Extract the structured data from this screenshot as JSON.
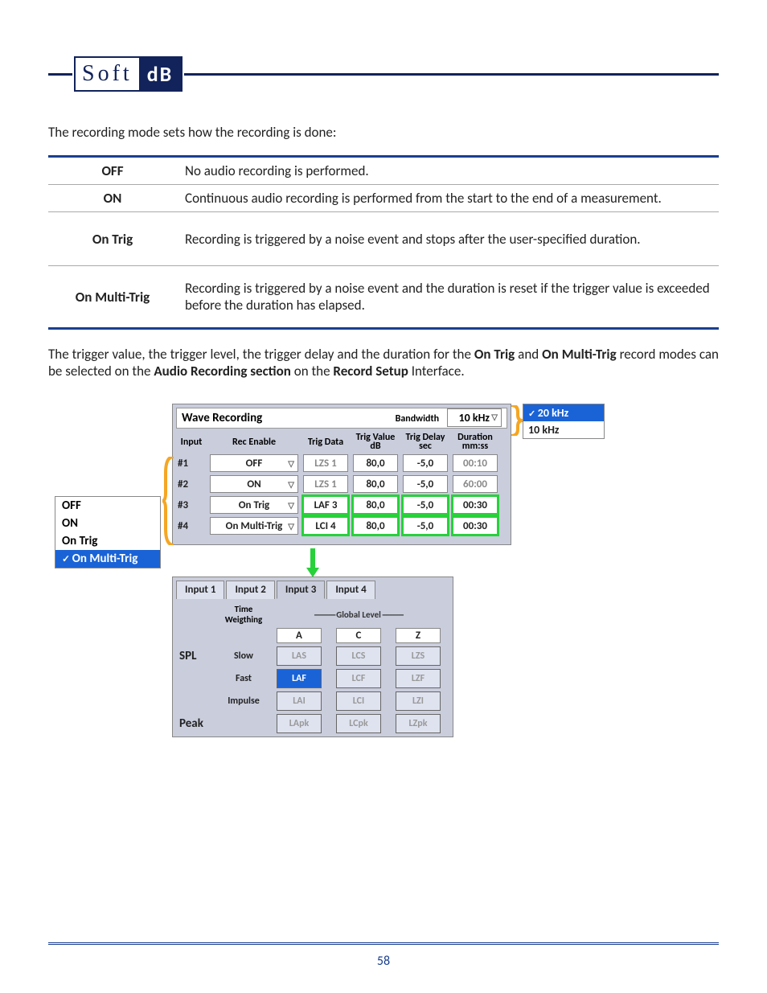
{
  "logo": {
    "left": "Soft",
    "right": "dB"
  },
  "intro": "The recording mode sets how the recording is done:",
  "modes": [
    {
      "name": "OFF",
      "desc": "No audio recording is performed."
    },
    {
      "name": "ON",
      "desc": "Continuous audio recording is performed from the start to the end of a measurement."
    },
    {
      "name": "On Trig",
      "desc": "Recording is triggered by a noise event and stops after the user-specified duration."
    },
    {
      "name": "On Multi-Trig",
      "desc": "Recording is triggered by a noise event and the duration is reset if the trigger value is exceeded before the duration has elapsed."
    }
  ],
  "para": {
    "p1": "The trigger value, the trigger level, the trigger delay and the duration for the ",
    "b1": "On Trig",
    "p2": " and ",
    "b2": "On Multi-Trig",
    "p3": " record modes can be selected on the ",
    "b3": "Audio Recording section",
    "p4": " on the ",
    "b4": "Record Setup",
    "p5": " Interface."
  },
  "wave": {
    "title": "Wave Recording",
    "bw_label": "Bandwidth",
    "bw_value": "10 kHz",
    "headers": {
      "input": "Input",
      "rec": "Rec Enable",
      "td": "Trig Data",
      "tv": "Trig Value",
      "tv2": "dB",
      "tdel": "Trig Delay",
      "tdel2": "sec",
      "dur": "Duration",
      "dur2": "mm:ss"
    },
    "rows": [
      {
        "in": "#1",
        "rec": "OFF",
        "td": "LZS 1",
        "tv": "80,0",
        "del": "-5,0",
        "dur": "00:10",
        "dim": true
      },
      {
        "in": "#2",
        "rec": "ON",
        "td": "LZS 1",
        "tv": "80,0",
        "del": "-5,0",
        "dur": "60:00",
        "dim": true
      },
      {
        "in": "#3",
        "rec": "On Trig",
        "td": "LAF 3",
        "tv": "80,0",
        "del": "-5,0",
        "dur": "00:30",
        "hl": true
      },
      {
        "in": "#4",
        "rec": "On Multi-Trig",
        "td": "LCI 4",
        "tv": "80,0",
        "del": "-5,0",
        "dur": "00:30",
        "hl": true
      }
    ]
  },
  "rec_dropdown": [
    "OFF",
    "ON",
    "On Trig",
    "On Multi-Trig"
  ],
  "rec_dropdown_selected": 3,
  "bw_dropdown": [
    "20 kHz",
    "10 kHz"
  ],
  "bw_dropdown_selected": 0,
  "spl": {
    "tabs": [
      "Input 1",
      "Input 2",
      "Input 3",
      "Input 4"
    ],
    "tab_selected": 2,
    "global_label": "Global Level",
    "tw_label": "Time Weigthing",
    "cols": [
      "A",
      "C",
      "Z"
    ],
    "rows": [
      {
        "metric": "SPL",
        "tw": "Slow",
        "cells": [
          "LAS",
          "LCS",
          "LZS"
        ],
        "on": -1
      },
      {
        "metric": "",
        "tw": "Fast",
        "cells": [
          "LAF",
          "LCF",
          "LZF"
        ],
        "on": 0
      },
      {
        "metric": "",
        "tw": "Impulse",
        "cells": [
          "LAI",
          "LCI",
          "LZI"
        ],
        "on": -1
      },
      {
        "metric": "Peak",
        "tw": "",
        "cells": [
          "LApk",
          "LCpk",
          "LZpk"
        ],
        "on": -1
      }
    ]
  },
  "page_number": "58"
}
